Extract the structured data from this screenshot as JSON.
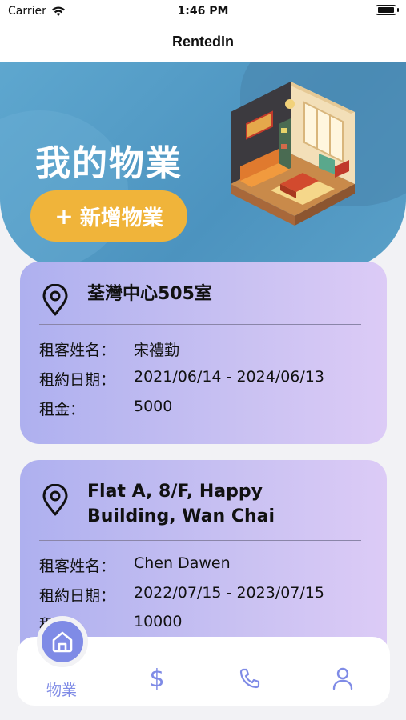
{
  "status": {
    "carrier": "Carrier",
    "time": "1:46 PM"
  },
  "nav": {
    "title": "RentedIn"
  },
  "hero": {
    "title": "我的物業",
    "add_label": "新增物業"
  },
  "properties": [
    {
      "address": "荃灣中心505室",
      "tenant_label": "租客姓名：",
      "tenant": "宋禮勤",
      "period_label": "租約日期：",
      "period": "2021/06/14 - 2024/06/13",
      "rent_label": "租金：",
      "rent": "5000"
    },
    {
      "address": "Flat A, 8/F, Happy Building, Wan Chai",
      "tenant_label": "租客姓名：",
      "tenant": "Chen Dawen",
      "period_label": "租約日期：",
      "period": "2022/07/15 - 2023/07/15",
      "rent_label": "租金：",
      "rent": "10000"
    }
  ],
  "tabbar": {
    "active_label": "物業",
    "accent": "#7f8be6",
    "icons": [
      "home-icon",
      "dollar-icon",
      "phone-icon",
      "user-icon"
    ]
  },
  "colors": {
    "hero_bg": "#5ea7cf",
    "add_button": "#f0b43a",
    "card_start": "#aeb0ef",
    "card_end": "#dccbf6"
  }
}
